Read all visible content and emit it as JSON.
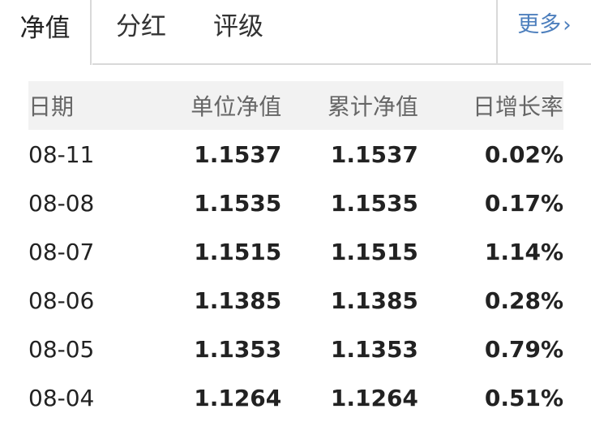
{
  "tabs": {
    "active": "净值",
    "dividend": "分红",
    "rating": "评级"
  },
  "more": {
    "label": "更多",
    "chevron": "›",
    "color": "#4d7fbd"
  },
  "table": {
    "headers": [
      "日期",
      "单位净值",
      "累计净值",
      "日增长率"
    ],
    "rows": [
      {
        "date": "08-11",
        "unit_nav": "1.1537",
        "accum_nav": "1.1537",
        "growth": "0.02%"
      },
      {
        "date": "08-08",
        "unit_nav": "1.1535",
        "accum_nav": "1.1535",
        "growth": "0.17%"
      },
      {
        "date": "08-07",
        "unit_nav": "1.1515",
        "accum_nav": "1.1515",
        "growth": "1.14%"
      },
      {
        "date": "08-06",
        "unit_nav": "1.1385",
        "accum_nav": "1.1385",
        "growth": "0.28%"
      },
      {
        "date": "08-05",
        "unit_nav": "1.1353",
        "accum_nav": "1.1353",
        "growth": "0.79%"
      },
      {
        "date": "08-04",
        "unit_nav": "1.1264",
        "accum_nav": "1.1264",
        "growth": "0.51%"
      }
    ],
    "growth_color": "#ff0000"
  }
}
